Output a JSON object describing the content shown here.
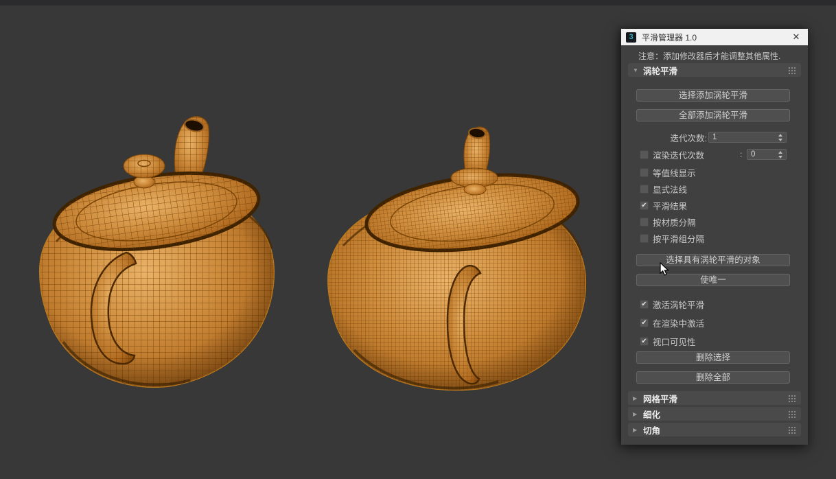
{
  "window": {
    "app_icon_glyph": "3",
    "title": "平滑管理器 1.0",
    "close_glyph": "✕"
  },
  "note": "注意：添加修改器后才能调整其他属性.",
  "glyphs": {
    "expanded": "▼",
    "collapsed": "▶",
    "check": "✔"
  },
  "turbosmooth": {
    "label": "涡轮平滑",
    "buttons": {
      "add_selected": "选择添加涡轮平滑",
      "add_all": "全部添加涡轮平滑",
      "select_objects": "选择具有涡轮平滑的对象",
      "make_unique": "使唯一",
      "delete_selected": "删除选择",
      "delete_all": "删除全部"
    },
    "spinners": {
      "iterations": {
        "label": "迭代次数:",
        "value": "1"
      },
      "render_iterations": {
        "label": "渲染迭代次数",
        "colon": ":",
        "value": "0",
        "checked": false
      }
    },
    "display_checkboxes": [
      {
        "label": "等值线显示",
        "checked": false
      },
      {
        "label": "显式法线",
        "checked": false
      },
      {
        "label": "平滑结果",
        "checked": true
      },
      {
        "label": "按材质分隔",
        "checked": false
      },
      {
        "label": "按平滑组分隔",
        "checked": false
      }
    ],
    "state_checkboxes": [
      {
        "label": "激活涡轮平滑",
        "checked": true
      },
      {
        "label": "在渲染中激活",
        "checked": true
      },
      {
        "label": "视口可见性",
        "checked": true
      }
    ]
  },
  "collapsed_rollouts": [
    {
      "label": "网格平滑"
    },
    {
      "label": "细化"
    },
    {
      "label": "切角"
    }
  ],
  "colors": {
    "viewport_bg": "#383838",
    "panel_bg": "#404040",
    "teapot_orange": "#c9833a",
    "wireframe": "#6e3d04",
    "titlebar_bg": "#f1f1f1",
    "logo_teal": "#35aec6"
  }
}
